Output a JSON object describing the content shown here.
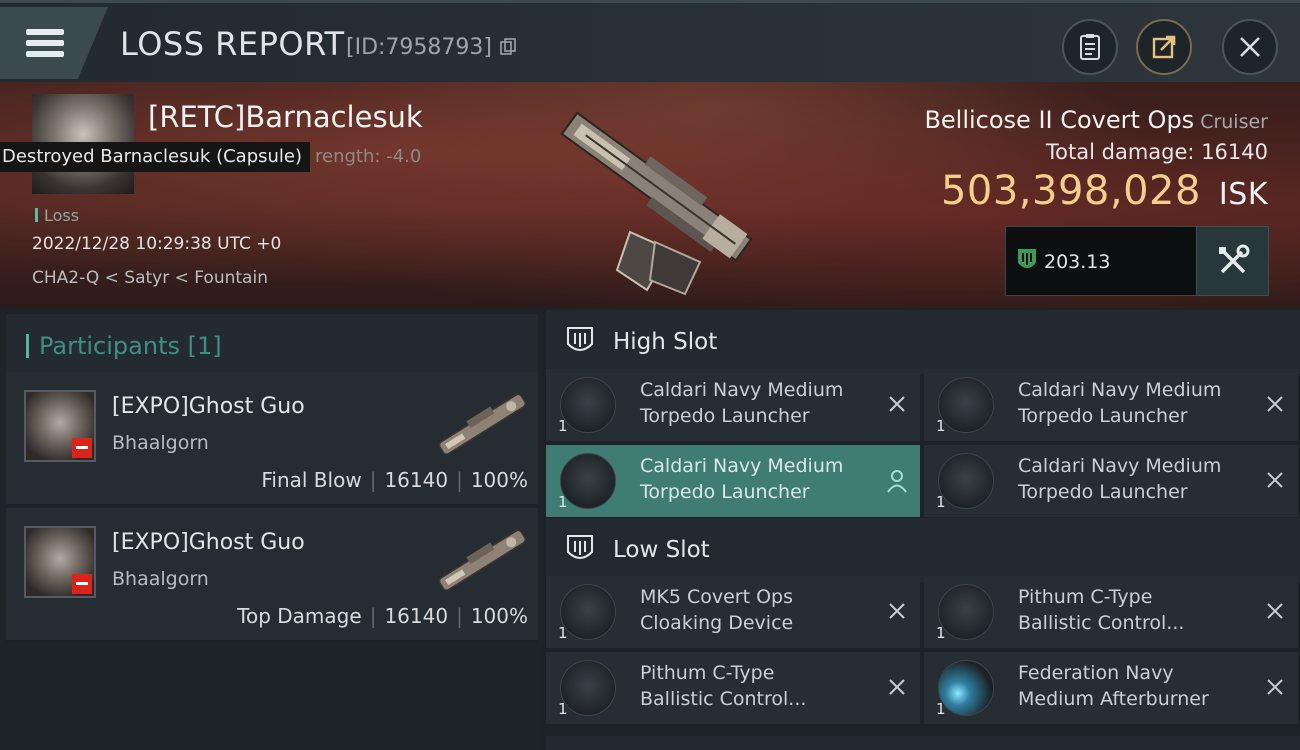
{
  "header": {
    "title": "LOSS REPORT",
    "report_id": "[ID:7958793]"
  },
  "victim": {
    "pilot_name": "[RETC]Barnaclesuk",
    "tooltip": "Destroyed Barnaclesuk (Capsule)",
    "strength_fragment": "rength: -4.0",
    "loss_label": "Loss",
    "datetime": "2022/12/28 10:29:38 UTC +0",
    "location": "CHA2-Q < Satyr < Fountain"
  },
  "ship": {
    "name": "Bellicose II Covert Ops",
    "class": "Cruiser",
    "total_damage_label": "Total damage:",
    "total_damage": "16140",
    "isk_value": "503,398,028",
    "isk_unit": "ISK",
    "rating": "203.13"
  },
  "participants": {
    "title": "Participants",
    "count": "[1]",
    "rows": [
      {
        "name": "[EXPO]Ghost Guo",
        "ship": "Bhaalgorn",
        "role": "Final Blow",
        "damage": "16140",
        "percent": "100%"
      },
      {
        "name": "[EXPO]Ghost Guo",
        "ship": "Bhaalgorn",
        "role": "Top Damage",
        "damage": "16140",
        "percent": "100%"
      }
    ]
  },
  "slots": {
    "high": {
      "label": "High Slot",
      "items": [
        {
          "qty": "1",
          "line1": "Caldari Navy Medium",
          "line2": "Torpedo Launcher"
        },
        {
          "qty": "1",
          "line1": "Caldari Navy Medium",
          "line2": "Torpedo Launcher"
        },
        {
          "qty": "1",
          "line1": "Caldari Navy Medium",
          "line2": "Torpedo Launcher"
        },
        {
          "qty": "1",
          "line1": "Caldari Navy Medium",
          "line2": "Torpedo Launcher"
        }
      ]
    },
    "low": {
      "label": "Low Slot",
      "items": [
        {
          "qty": "1",
          "line1": "MK5 Covert Ops",
          "line2": "Cloaking Device"
        },
        {
          "qty": "1",
          "line1": "Pithum C-Type",
          "line2": "Ballistic Control..."
        },
        {
          "qty": "1",
          "line1": "Pithum C-Type",
          "line2": "Ballistic Control..."
        },
        {
          "qty": "1",
          "line1": "Federation Navy",
          "line2": "Medium Afterburner"
        }
      ]
    }
  },
  "colors": {
    "accent_teal": "#56b3a5",
    "isk_gold": "#f2cf8d",
    "active_item": "#3f7c74",
    "badge_red": "#d8251c"
  },
  "icons": [
    "menu-icon",
    "copy-icon",
    "clipboard-icon",
    "share-icon",
    "close-icon",
    "security-shield-icon",
    "fitting-tools-icon",
    "slot-shield-icon",
    "remove-icon",
    "person-icon"
  ]
}
